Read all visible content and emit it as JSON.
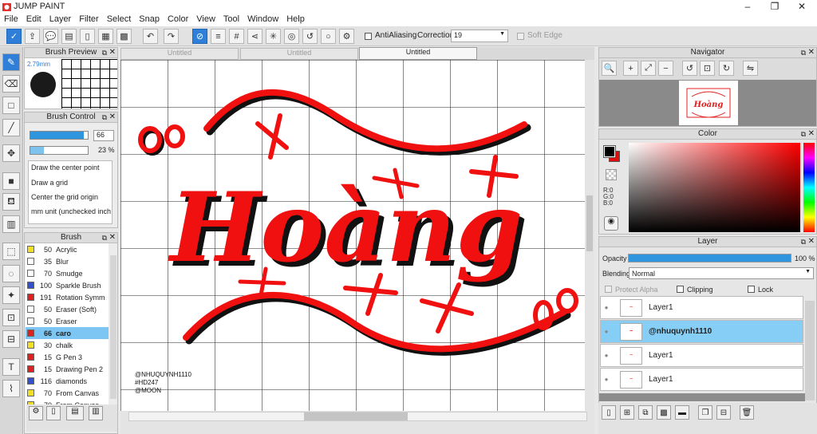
{
  "app": {
    "title": "JUMP PAINT"
  },
  "menu": [
    "File",
    "Edit",
    "Layer",
    "Filter",
    "Select",
    "Snap",
    "Color",
    "View",
    "Tool",
    "Window",
    "Help"
  ],
  "toolbar": {
    "antialias_label": "AntiAliasing",
    "correction_label": "Correction",
    "correction_value": "19",
    "soft_edge_label": "Soft Edge"
  },
  "tabs": [
    {
      "label": "Untitled"
    },
    {
      "label": "Untitled"
    },
    {
      "label": "Untitled"
    }
  ],
  "brush_preview": {
    "title": "Brush Preview",
    "size_label": "2.79mm"
  },
  "brush_control": {
    "title": "Brush Control",
    "slider1_value": "66",
    "slider1_fill": 0.93,
    "slider2_value": "23 %",
    "slider2_fill": 0.23,
    "options": [
      "Draw the center point",
      "Draw a grid",
      "Center the grid origin",
      "mm unit (unchecked inch"
    ]
  },
  "brush": {
    "title": "Brush",
    "items": [
      {
        "size": "50",
        "name": "Acrylic",
        "color": "#f0e020"
      },
      {
        "size": "35",
        "name": "Blur",
        "color": "#ffffff"
      },
      {
        "size": "70",
        "name": "Smudge",
        "color": "#ffffff"
      },
      {
        "size": "100",
        "name": "Sparkle Brush",
        "color": "#3050d0"
      },
      {
        "size": "191",
        "name": "Rotation Symm",
        "color": "#e02020"
      },
      {
        "size": "50",
        "name": "Eraser (Soft)",
        "color": "#ffffff"
      },
      {
        "size": "50",
        "name": "Eraser",
        "color": "#ffffff"
      },
      {
        "size": "66",
        "name": "caro",
        "color": "#e02020"
      },
      {
        "size": "30",
        "name": "chalk",
        "color": "#f0e020"
      },
      {
        "size": "15",
        "name": "G Pen 3",
        "color": "#e02020"
      },
      {
        "size": "15",
        "name": "Drawing Pen 2",
        "color": "#e02020"
      },
      {
        "size": "116",
        "name": "diamonds",
        "color": "#3050d0"
      },
      {
        "size": "70",
        "name": "From Canvas",
        "color": "#f0e020"
      },
      {
        "size": "70",
        "name": "From Canvas",
        "color": "#f0e020"
      }
    ]
  },
  "canvas": {
    "main_text": "Hoàng",
    "watermark": [
      "@NHUQUYNH1110",
      "#HD247",
      "@MOON"
    ]
  },
  "navigator": {
    "title": "Navigator"
  },
  "color": {
    "title": "Color",
    "r": "R:0",
    "g": "G:0",
    "b": "B:0",
    "primary": "#000000",
    "secondary": "#e01010",
    "hue": "#ff0000"
  },
  "layer": {
    "title": "Layer",
    "opacity_label": "Opacity",
    "opacity_value": "100 %",
    "opacity_fill": 1.0,
    "blending_label": "Blending",
    "blending_value": "Normal",
    "protect_alpha_label": "Protect Alpha",
    "clipping_label": "Clipping",
    "lock_label": "Lock",
    "items": [
      {
        "name": "Layer1",
        "selected": false
      },
      {
        "name": "@nhuquynh1110",
        "selected": true
      },
      {
        "name": "Layer1",
        "selected": false
      },
      {
        "name": "Layer1",
        "selected": false
      }
    ]
  },
  "colors": {
    "accent": "#2f7fd8",
    "selected_row": "#86cef5",
    "stroke_red": "#f01010"
  }
}
